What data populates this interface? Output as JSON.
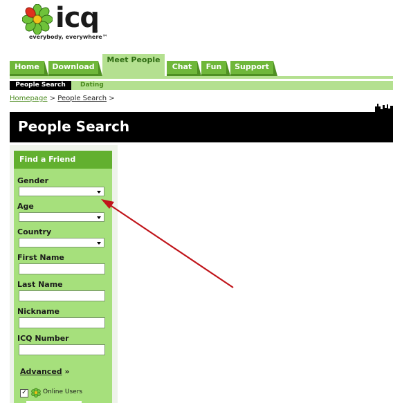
{
  "logo": {
    "word": "icq",
    "registered": "®",
    "tagline": "everybody, everywhere™",
    "icon": "flower-icon"
  },
  "nav": {
    "tabs": [
      {
        "label": "Home"
      },
      {
        "label": "Download"
      },
      {
        "label": "Meet People",
        "active": true
      },
      {
        "label": "Chat"
      },
      {
        "label": "Fun"
      },
      {
        "label": "Support"
      }
    ]
  },
  "subnav": {
    "active": "People Search",
    "other": "Dating"
  },
  "breadcrumb": {
    "home": "Homepage",
    "sep1": ">",
    "current": "People Search",
    "sep2": ">"
  },
  "page": {
    "title": "People Search"
  },
  "form": {
    "header": "Find a Friend",
    "gender_label": "Gender",
    "age_label": "Age",
    "country_label": "Country",
    "first_name_label": "First Name",
    "last_name_label": "Last Name",
    "nickname_label": "Nickname",
    "icq_label": "ICQ Number",
    "advanced_label": "Advanced",
    "advanced_arrow": "»",
    "online_label": "Online Users",
    "online_checked": "✓"
  },
  "colors": {
    "green": "#6fb73a",
    "light_green": "#b4e090",
    "arrow": "#c0141a",
    "black": "#000000"
  }
}
